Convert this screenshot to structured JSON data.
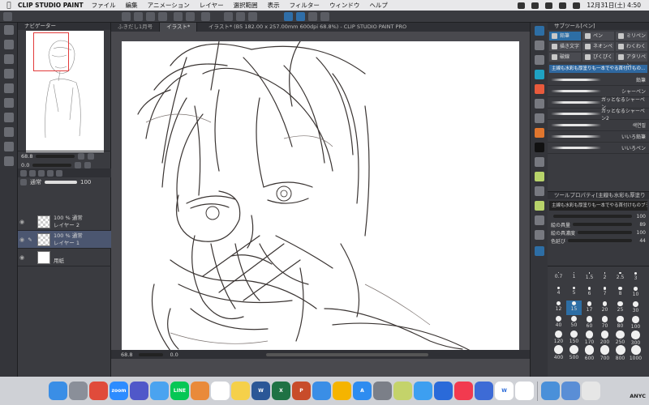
{
  "menubar": {
    "app_name": "CLIP STUDIO PAINT",
    "menus": [
      "ファイル",
      "編集",
      "アニメーション",
      "レイヤー",
      "選択範囲",
      "表示",
      "フィルター",
      "ウィンドウ",
      "ヘルプ"
    ],
    "clock": "12月31日(土)  4:50"
  },
  "window": {
    "title": "イラスト* (B5 182.00 x 257.00mm 600dpi 68.8%) - CLIP STUDIO PAINT PRO"
  },
  "doc_tabs": [
    "ふきだし1月号",
    "イラスト*"
  ],
  "navigator": {
    "title": "ナビゲーター",
    "zoom": "68.8",
    "angle": "0.0"
  },
  "layer_controls": {
    "blend_mode": "通常",
    "opacity": "100"
  },
  "layers": [
    {
      "line1": "100 % 通常",
      "line2": "レイヤー 2"
    },
    {
      "line1": "100 % 通常",
      "line2": "レイヤー 1"
    },
    {
      "line1": "",
      "line2": "用紙"
    }
  ],
  "status": {
    "zoom": "68.8",
    "angle": "0.0"
  },
  "subtool": {
    "title": "サブツール[ペン]",
    "tabs": [
      "鉛筆",
      "ペン",
      "ミリペン",
      "描き文字",
      "ネオンペン",
      "わくわく",
      "破線",
      "ぴくぴく",
      "アタリペン"
    ],
    "selected_brush": "主線も水彩も厚塗りも一本でやる首付けもの…",
    "brushes": [
      "鉛筆",
      "シャーペン",
      "ガッとなるシャーペン",
      "ガッとなるシャーペン2",
      "색연필",
      "いいろ鉛筆",
      "いいろペン"
    ]
  },
  "tool_property": {
    "title": "ツールプロパティ[主線も水彩も厚塗り",
    "header_value": "主線も水彩も厚塗りも一本でやる首付けものブラシ",
    "rows": [
      {
        "label": "",
        "value": "100"
      },
      {
        "label": "絵の具量",
        "value": "89"
      },
      {
        "label": "絵の具濃度",
        "value": "100"
      },
      {
        "label": "色延び",
        "value": "44"
      }
    ]
  },
  "brush_sizes": [
    "0.7",
    "1",
    "1.5",
    "2",
    "2.5",
    "3",
    "4",
    "5",
    "6",
    "7",
    "8",
    "10",
    "12",
    "15",
    "17",
    "20",
    "25",
    "30",
    "40",
    "50",
    "60",
    "70",
    "80",
    "100",
    "120",
    "150",
    "170",
    "200",
    "250",
    "300",
    "400",
    "500",
    "600",
    "700",
    "800",
    "1000"
  ],
  "brush_size_selected": "15",
  "dock": {
    "apps": [
      {
        "name": "Finder",
        "color": "#3a8ee6",
        "label": ""
      },
      {
        "name": "Launchpad",
        "color": "#8a8f99",
        "label": ""
      },
      {
        "name": "Chrome",
        "color": "#e04b3b",
        "label": ""
      },
      {
        "name": "Zoom",
        "color": "#2d8cff",
        "label": "zoom"
      },
      {
        "name": "Teams",
        "color": "#5058c9",
        "label": ""
      },
      {
        "name": "iCloud",
        "color": "#4aa3f0",
        "label": ""
      },
      {
        "name": "LINE",
        "color": "#06c755",
        "label": "LINE"
      },
      {
        "name": "Photos",
        "color": "#e98a3a",
        "label": ""
      },
      {
        "name": "Calendar",
        "color": "#ffffff",
        "label": ""
      },
      {
        "name": "Notes",
        "color": "#f5d04a",
        "label": ""
      },
      {
        "name": "Word",
        "color": "#2b5797",
        "label": "W"
      },
      {
        "name": "Excel",
        "color": "#1f7244",
        "label": "X"
      },
      {
        "name": "PowerPoint",
        "color": "#c84c2a",
        "label": "P"
      },
      {
        "name": "Mail",
        "color": "#3a8ee6",
        "label": ""
      },
      {
        "name": "Keynote",
        "color": "#f5b400",
        "label": ""
      },
      {
        "name": "App Store",
        "color": "#2e8cf0",
        "label": "A"
      },
      {
        "name": "System Preferences",
        "color": "#7b7f88",
        "label": ""
      },
      {
        "name": "Clip Studio",
        "color": "#c4d36a",
        "label": ""
      },
      {
        "name": "Safari",
        "color": "#3d9ff0",
        "label": ""
      },
      {
        "name": "Canvas",
        "color": "#2a6ad9",
        "label": ""
      },
      {
        "name": "Music",
        "color": "#f23a4f",
        "label": ""
      },
      {
        "name": "Remote",
        "color": "#3d6bd6",
        "label": ""
      },
      {
        "name": "Wacom",
        "color": "#ffffff",
        "label": "W"
      },
      {
        "name": "Clip Studio Paint",
        "color": "#ffffff",
        "label": ""
      },
      {
        "name": "Transfer",
        "color": "#4a90d9",
        "label": ""
      },
      {
        "name": "Folder",
        "color": "#5a8ed6",
        "label": ""
      },
      {
        "name": "Trash",
        "color": "#e6e6e6",
        "label": ""
      }
    ],
    "badge": "ANYC"
  }
}
